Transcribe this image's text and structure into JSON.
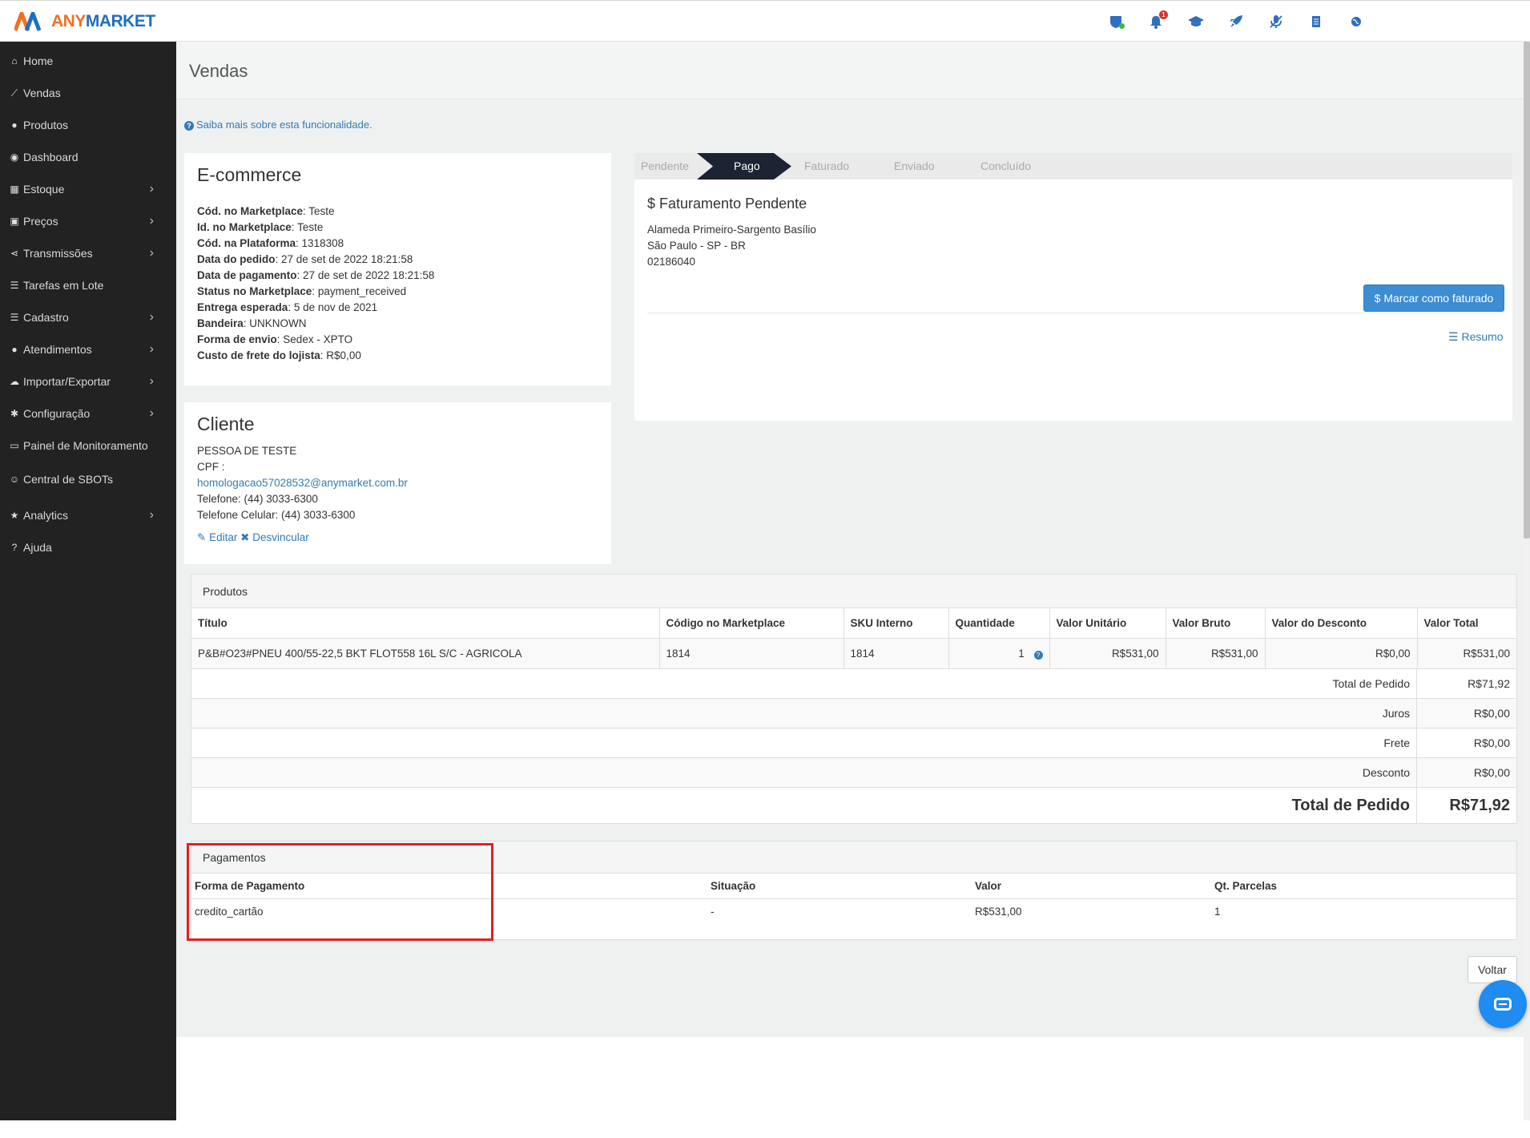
{
  "brand": {
    "any": "ANY",
    "market": "MARKET"
  },
  "topbar_icons": [
    "shield-icon",
    "bell-icon",
    "graduation-cap-icon",
    "rocket-icon",
    "microphone-icon",
    "document-icon",
    "globe-icon"
  ],
  "notification_badge": "1",
  "sidebar": {
    "items": [
      {
        "label": "Home",
        "icon": "home-icon"
      },
      {
        "label": "Vendas",
        "icon": "chart-line-icon"
      },
      {
        "label": "Produtos",
        "icon": "product-icon"
      },
      {
        "label": "Dashboard",
        "icon": "dashboard-icon"
      },
      {
        "label": "Estoque",
        "icon": "cubes-icon"
      },
      {
        "label": "Preços",
        "icon": "money-icon"
      },
      {
        "label": "Transmissões",
        "icon": "share-icon"
      },
      {
        "label": "Tarefas em Lote",
        "icon": "list-icon"
      },
      {
        "label": "Cadastro",
        "icon": "list-icon"
      },
      {
        "label": "Atendimentos",
        "icon": "comments-icon"
      },
      {
        "label": "Importar/Exportar",
        "icon": "cloud-icon"
      },
      {
        "label": "Configuração",
        "icon": "gear-icon"
      },
      {
        "label": "Painel de Monitoramento",
        "icon": "monitor-icon"
      },
      {
        "label": "Central de SBOTs",
        "icon": "robot-icon"
      },
      {
        "label": "Analytics",
        "icon": "star-icon"
      },
      {
        "label": "Ajuda",
        "icon": "question-icon"
      }
    ]
  },
  "page": {
    "title": "Vendas",
    "help_link": "Saiba mais sobre esta funcionalidade."
  },
  "ecommerce": {
    "title": "E-commerce",
    "fields": [
      {
        "label": "Cód. no Marketplace",
        "value": "Teste"
      },
      {
        "label": "Id. no Marketplace",
        "value": "Teste"
      },
      {
        "label": "Cód. na Plataforma",
        "value": "1318308"
      },
      {
        "label": "Data do pedido",
        "value": "27 de set de 2022 18:21:58"
      },
      {
        "label": "Data de pagamento",
        "value": "27 de set de 2022 18:21:58"
      },
      {
        "label": "Status no Marketplace",
        "value": "payment_received"
      },
      {
        "label": "Entrega esperada",
        "value": "5 de nov de 2021"
      },
      {
        "label": "Bandeira",
        "value": "UNKNOWN"
      },
      {
        "label": "Forma de envio",
        "value": "Sedex - XPTO"
      },
      {
        "label": "Custo de frete do lojista",
        "value": "R$0,00"
      }
    ]
  },
  "cliente": {
    "title": "Cliente",
    "name": "PESSOA DE TESTE",
    "cpf": "CPF :",
    "email": "homologacao57028532@anymarket.com.br",
    "telefone": "Telefone: (44) 3033-6300",
    "celular": "Telefone Celular: (44) 3033-6300",
    "edit": "Editar",
    "unlink": "Desvincular"
  },
  "status": {
    "steps": [
      "Pendente",
      "Pago",
      "Faturado",
      "Enviado",
      "Concluído"
    ],
    "active": "Pago",
    "title": "Faturamento Pendente",
    "address": [
      "Alameda Primeiro-Sargento Basílio",
      "São Paulo - SP - BR",
      "02186040"
    ],
    "button": "Marcar como faturado",
    "resumo": "Resumo"
  },
  "produtos": {
    "title": "Produtos",
    "columns": [
      "Título",
      "Código no Marketplace",
      "SKU Interno",
      "Quantidade",
      "Valor Unitário",
      "Valor Bruto",
      "Valor do Desconto",
      "Valor Total"
    ],
    "rows": [
      [
        "P&B#O23#PNEU 400/55-22,5 BKT FLOT558 16L S/C - AGRICOLA",
        "1814",
        "1814",
        "1",
        "R$531,00",
        "R$531,00",
        "R$0,00",
        "R$531,00"
      ]
    ],
    "totals": [
      {
        "label": "Total de Pedido",
        "value": "R$71,92"
      },
      {
        "label": "Juros",
        "value": "R$0,00"
      },
      {
        "label": "Frete",
        "value": "R$0,00"
      },
      {
        "label": "Desconto",
        "value": "R$0,00"
      }
    ],
    "grand_total": {
      "label": "Total de Pedido",
      "value": "R$71,92"
    }
  },
  "pagamentos": {
    "title": "Pagamentos",
    "columns": [
      "Forma de Pagamento",
      "Situação",
      "Valor",
      "Qt. Parcelas"
    ],
    "rows": [
      [
        "credito_cartão",
        "-",
        "R$531,00",
        "1"
      ]
    ]
  },
  "voltar": "Voltar",
  "colors": {
    "accent": "#337ab7",
    "sidebar": "#222222",
    "primary_button": "#3c8dd2",
    "highlight": "#e21f26",
    "step_active": "#1c2333"
  }
}
